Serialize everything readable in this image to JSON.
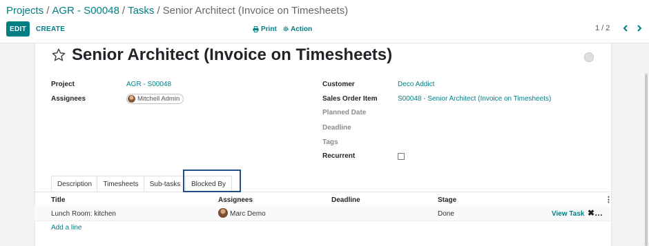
{
  "breadcrumb": {
    "items": [
      "Projects",
      "AGR - S00048",
      "Tasks"
    ],
    "separator": "/",
    "current": "Senior Architect (Invoice on Timesheets)"
  },
  "control_panel": {
    "edit_label": "EDIT",
    "create_label": "CREATE",
    "print_label": "Print",
    "action_label": "Action",
    "pager": "1 / 2"
  },
  "record": {
    "title": "Senior Architect (Invoice on Timesheets)",
    "fields_left": {
      "project_label": "Project",
      "project_value": "AGR - S00048",
      "assignees_label": "Assignees",
      "assignee_name": "Mitchell Admin"
    },
    "fields_right": {
      "customer_label": "Customer",
      "customer_value": "Deco Addict",
      "sales_order_item_label": "Sales Order Item",
      "sales_order_item_value": "S00048 - Senior Architect (Invoice on Timesheets)",
      "planned_date_label": "Planned Date",
      "deadline_label": "Deadline",
      "tags_label": "Tags",
      "recurrent_label": "Recurrent"
    }
  },
  "tabs": [
    {
      "label": "Description"
    },
    {
      "label": "Timesheets"
    },
    {
      "label": "Sub-tasks"
    },
    {
      "label": "Blocked By",
      "active": true
    }
  ],
  "table": {
    "columns": [
      "Title",
      "Assignees",
      "Deadline",
      "Stage"
    ],
    "rows": [
      {
        "title": "Lunch Room: kitchen",
        "assignee": "Marc Demo",
        "deadline": "",
        "stage": "Done",
        "action": "View Task"
      }
    ],
    "add_line": "Add a line"
  },
  "icons": {
    "favorite": "star-icon",
    "print": "print-icon",
    "action": "gear-icon",
    "prev": "chevron-left-icon",
    "next": "chevron-right-icon",
    "remove": "close-icon",
    "column_options": "kebab-icon"
  },
  "colors": {
    "accent": "#017e84",
    "highlight_border": "#1e4f86"
  }
}
